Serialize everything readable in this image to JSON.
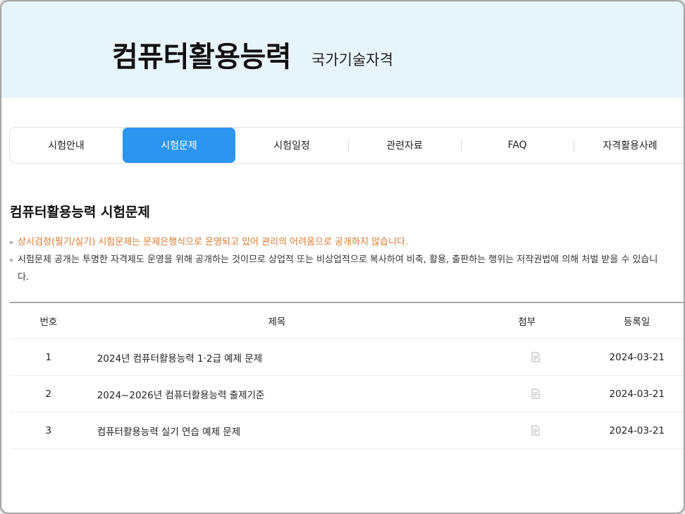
{
  "header": {
    "title": "컴퓨터활용능력",
    "subtitle": "국가기술자격"
  },
  "tabs": [
    {
      "label": "시험안내",
      "active": false
    },
    {
      "label": "시험문제",
      "active": true
    },
    {
      "label": "시험일정",
      "active": false
    },
    {
      "label": "관련자료",
      "active": false
    },
    {
      "label": "FAQ",
      "active": false
    },
    {
      "label": "자격활용사례",
      "active": false
    }
  ],
  "section": {
    "title": "컴퓨터활용능력 시험문제",
    "notice_warning": "상시검정(필기/실기) 시험문제는 문제은행식으로 운영되고 있어 관리의 어려움으로 공개하지 않습니다.",
    "notice_info": "시험문제 공개는 투명한 자격제도 운영을 위해 공개하는 것이므로 상업적 또는 비상업적으로 복사하여 비축, 활용, 출판하는 행위는 저작권법에 의해 처벌 받을 수 있습니다."
  },
  "table": {
    "columns": {
      "num": "번호",
      "title": "제목",
      "attach": "첨부",
      "date": "등록일"
    },
    "rows": [
      {
        "num": "1",
        "title": "2024년 컴퓨터활용능력 1·2급 예제 문제",
        "attach_icon": "document-icon",
        "date": "2024-03-21"
      },
      {
        "num": "2",
        "title": "2024~2026년 컴퓨터활용능력 출제기준",
        "attach_icon": "document-icon",
        "date": "2024-03-21"
      },
      {
        "num": "3",
        "title": "컴퓨터활용능력 실기 연습 예제 문제",
        "attach_icon": "document-icon",
        "date": "2024-03-21"
      }
    ]
  },
  "colors": {
    "accent": "#2b95f0",
    "hero_bg": "#e8f4fb",
    "warning_text": "#d8782e"
  }
}
